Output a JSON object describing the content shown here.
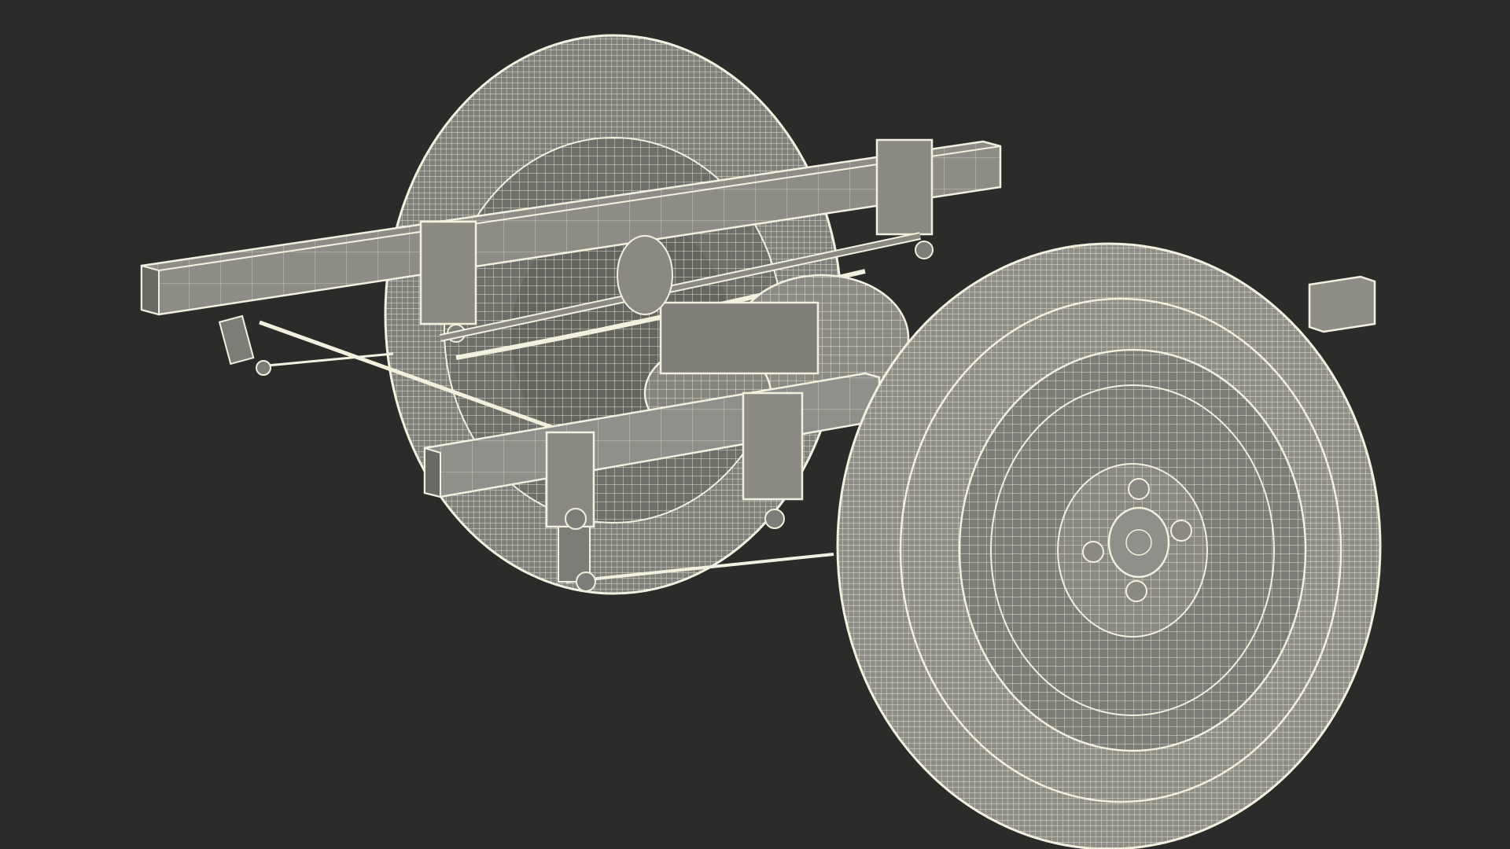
{
  "scene": {
    "background_color": "#2b2b2a",
    "surface_color": "#8a8a82",
    "surface_dark_color": "#5c5c56",
    "wire_color": "#f2f0df",
    "subject": "wireframe-axle-assembly",
    "render_style": "wireframe-over-shaded",
    "objects": [
      {
        "name": "rear-tire-icon"
      },
      {
        "name": "front-tire-icon"
      },
      {
        "name": "upper-frame-rail-icon"
      },
      {
        "name": "lower-frame-rail-icon"
      },
      {
        "name": "differential-housing-icon"
      },
      {
        "name": "leaf-spring-icon"
      },
      {
        "name": "shackle-icon"
      },
      {
        "name": "tie-rod-icon"
      },
      {
        "name": "hub-lug-nut-icon"
      }
    ]
  }
}
